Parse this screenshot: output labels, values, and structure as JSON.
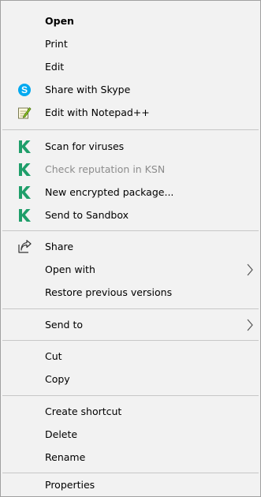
{
  "menu": {
    "items": {
      "open": "Open",
      "print": "Print",
      "edit": "Edit",
      "skype": "Share with Skype",
      "notepad": "Edit with Notepad++",
      "scan": "Scan for viruses",
      "ksn": "Check reputation in KSN",
      "encrypted": "New encrypted package...",
      "sandbox": "Send to Sandbox",
      "share": "Share",
      "open_with": "Open with",
      "restore": "Restore previous versions",
      "send_to": "Send to",
      "cut": "Cut",
      "copy": "Copy",
      "shortcut": "Create shortcut",
      "delete": "Delete",
      "rename": "Rename",
      "properties": "Properties"
    }
  },
  "colors": {
    "menu_background": "#f2f2f2",
    "separator": "#c7c7c7",
    "disabled_text": "#8c8c8c",
    "skype_blue": "#00a9f0",
    "kaspersky_green": "#1f9e6a"
  },
  "icons": {
    "skype": "skype-icon",
    "notepad": "notepad-plus-plus-icon",
    "kaspersky": "kaspersky-k-icon",
    "share": "share-icon",
    "submenu": "chevron-right-icon"
  }
}
